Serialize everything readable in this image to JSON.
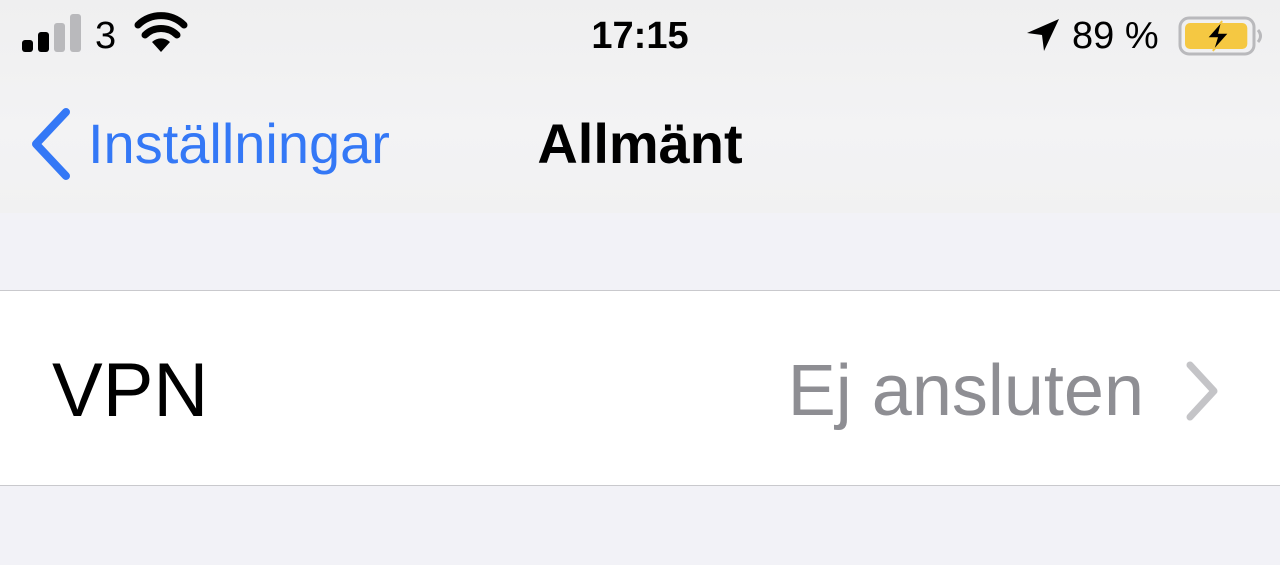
{
  "status_bar": {
    "carrier": "3",
    "time": "17:15",
    "battery_text": "89 %",
    "battery_level": 0.89,
    "charging": true,
    "icons": [
      "signal-icon",
      "wifi-icon",
      "location-icon",
      "battery-icon"
    ]
  },
  "nav": {
    "back_label": "Inställningar",
    "title": "Allmänt"
  },
  "rows": [
    {
      "label": "VPN",
      "value": "Ej ansluten",
      "icon": "chevron-right-icon"
    }
  ],
  "colors": {
    "accent": "#3478f6",
    "secondary_text": "#8e8e93",
    "background": "#f2f2f7",
    "battery_fill": "#f5c842"
  }
}
